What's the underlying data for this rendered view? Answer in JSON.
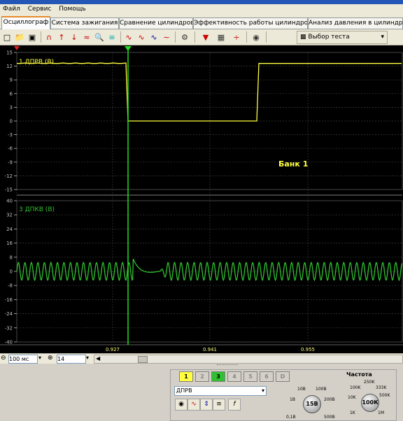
{
  "menu": [
    "Файл",
    "Сервис",
    "Помощь"
  ],
  "tabs": [
    "Осциллограф",
    "Система зажигания",
    "Сравнение цилиндров",
    "Эффективность работы цилиндров",
    "Анализ давления в цилиндре"
  ],
  "toolbar": {
    "test_select": "Выбор теста"
  },
  "scope": {
    "channel1_label": "1 ДПРВ (В)",
    "channel3_label": "3 ДПКВ (В)",
    "bank_label": "Банк 1",
    "ch1_ticks": [
      "15",
      "12",
      "9",
      "6",
      "3",
      "0",
      "-3",
      "-6",
      "-9",
      "-12",
      "-15"
    ],
    "ch3_ticks": [
      "40",
      "32",
      "24",
      "16",
      "8",
      "0",
      "-8",
      "-16",
      "-24",
      "-32",
      "-40"
    ],
    "time_ticks": [
      "0.927",
      "0.941",
      "0.955"
    ],
    "ch1_color": "#ffff40",
    "ch3_color": "#30c030",
    "cursor_color": "#22dd22"
  },
  "timebar": {
    "timebase": "100 мс",
    "buffer": "14"
  },
  "panel": {
    "channels": [
      "1",
      "2",
      "3",
      "4",
      "5",
      "6",
      "D"
    ],
    "selected_channel": "ДПРВ",
    "voltage": {
      "value": "15В",
      "labels": [
        "10В",
        "100В",
        "1В",
        "200В",
        "0,1В",
        "500В"
      ]
    },
    "frequency": {
      "title": "Частота",
      "value": "100К",
      "labels": [
        "250K",
        "100K",
        "333K",
        "10K",
        "500K",
        "1K",
        "1M"
      ]
    }
  }
}
